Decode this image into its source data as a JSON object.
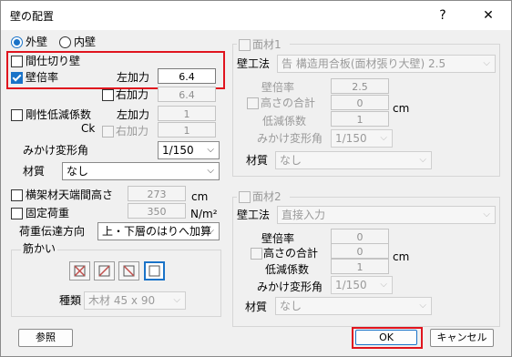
{
  "window": {
    "title": "壁の配置",
    "help": "?",
    "close": "✕"
  },
  "wall_type": {
    "outer": "外壁",
    "inner": "内壁"
  },
  "left": {
    "mashikiri": "間仕切り壁",
    "bairitsu": "壁倍率",
    "left_force_label": "左加力",
    "left_force_value": "6.4",
    "right_force_label": "右加力",
    "right_force_value": "6.4",
    "gosei": "剛性低減係数",
    "ck": "Ck",
    "gosei_left_label": "左加力",
    "gosei_left_value": "1",
    "gosei_right_label": "右加力",
    "gosei_right_value": "1",
    "henkei_label": "みかけ変形角",
    "henkei_value": "1/150",
    "zaishitsu_label": "材質",
    "zaishitsu_value": "なし",
    "height_label": "横架材天端間高さ",
    "height_value": "273",
    "height_unit": "cm",
    "kotei_label": "固定荷重",
    "kotei_value": "350",
    "kotei_unit": "N/m²",
    "load_label": "荷重伝達方向",
    "load_value": "上・下層のはりへ加算",
    "sujikai_group": "筋かい",
    "shurui_label": "種類",
    "shurui_value": "木材 45 x 90"
  },
  "menzai1": {
    "title": "面材1",
    "koho_label": "壁工法",
    "koho_value": "告 構造用合板(面材張り大壁) 2.5",
    "bairitsu_label": "壁倍率",
    "bairitsu_value": "2.5",
    "takasa_label": "高さの合計",
    "takasa_value": "0",
    "takasa_unit": "cm",
    "teigen_label": "低減係数",
    "teigen_value": "1",
    "henkei_label": "みかけ変形角",
    "henkei_value": "1/150",
    "zaishitsu_label": "材質",
    "zaishitsu_value": "なし"
  },
  "menzai2": {
    "title": "面材2",
    "koho_label": "壁工法",
    "koho_value": "直接入力",
    "bairitsu_label": "壁倍率",
    "bairitsu_value": "0",
    "takasa_label": "高さの合計",
    "takasa_value": "0",
    "takasa_unit": "cm",
    "teigen_label": "低減係数",
    "teigen_value": "1",
    "henkei_label": "みかけ変形角",
    "henkei_value": "1/150",
    "zaishitsu_label": "材質",
    "zaishitsu_value": "なし"
  },
  "buttons": {
    "ref": "参照",
    "ok": "OK",
    "cancel": "キャンセル"
  },
  "colors": {
    "accent": "#1a73c8",
    "highlight": "#e0141e",
    "brace_cross": "#c0504d"
  }
}
